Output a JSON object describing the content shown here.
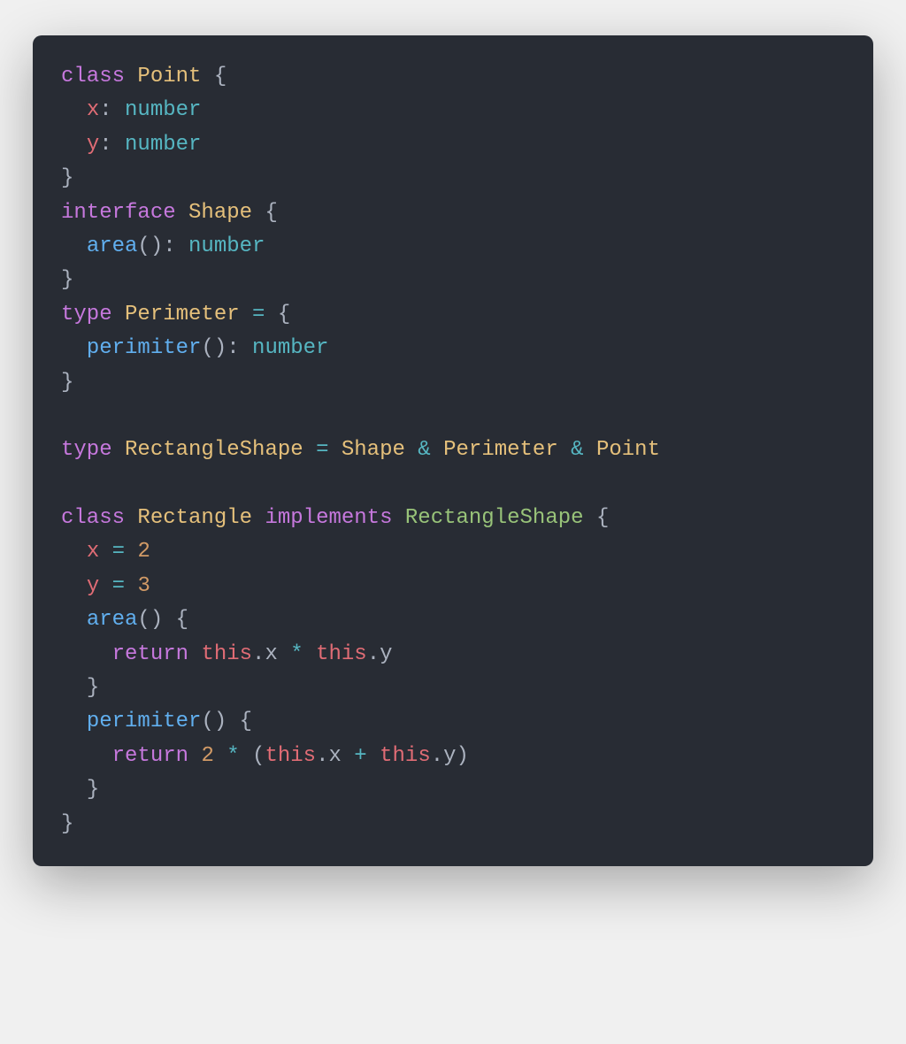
{
  "code": {
    "tokens": [
      [
        {
          "t": "class",
          "c": "kw"
        },
        {
          "t": " "
        },
        {
          "t": "Point",
          "c": "type"
        },
        {
          "t": " "
        },
        {
          "t": "{",
          "c": "punct"
        }
      ],
      [
        {
          "t": "  "
        },
        {
          "t": "x",
          "c": "prop"
        },
        {
          "t": ": "
        },
        {
          "t": "number",
          "c": "builtin"
        }
      ],
      [
        {
          "t": "  "
        },
        {
          "t": "y",
          "c": "prop"
        },
        {
          "t": ": "
        },
        {
          "t": "number",
          "c": "builtin"
        }
      ],
      [
        {
          "t": "}",
          "c": "punct"
        }
      ],
      [
        {
          "t": "interface",
          "c": "kw"
        },
        {
          "t": " "
        },
        {
          "t": "Shape",
          "c": "type"
        },
        {
          "t": " "
        },
        {
          "t": "{",
          "c": "punct"
        }
      ],
      [
        {
          "t": "  "
        },
        {
          "t": "area",
          "c": "method"
        },
        {
          "t": "(): "
        },
        {
          "t": "number",
          "c": "builtin"
        }
      ],
      [
        {
          "t": "}",
          "c": "punct"
        }
      ],
      [
        {
          "t": "type",
          "c": "kw"
        },
        {
          "t": " "
        },
        {
          "t": "Perimeter",
          "c": "type"
        },
        {
          "t": " "
        },
        {
          "t": "=",
          "c": "op"
        },
        {
          "t": " "
        },
        {
          "t": "{",
          "c": "punct"
        }
      ],
      [
        {
          "t": "  "
        },
        {
          "t": "perimiter",
          "c": "method"
        },
        {
          "t": "(): "
        },
        {
          "t": "number",
          "c": "builtin"
        }
      ],
      [
        {
          "t": "}",
          "c": "punct"
        }
      ],
      [
        {
          "t": ""
        }
      ],
      [
        {
          "t": "type",
          "c": "kw"
        },
        {
          "t": " "
        },
        {
          "t": "RectangleShape",
          "c": "type"
        },
        {
          "t": " "
        },
        {
          "t": "=",
          "c": "op"
        },
        {
          "t": " "
        },
        {
          "t": "Shape",
          "c": "type"
        },
        {
          "t": " "
        },
        {
          "t": "&",
          "c": "op"
        },
        {
          "t": " "
        },
        {
          "t": "Perimeter",
          "c": "type"
        },
        {
          "t": " "
        },
        {
          "t": "&",
          "c": "op"
        },
        {
          "t": " "
        },
        {
          "t": "Point",
          "c": "type"
        }
      ],
      [
        {
          "t": ""
        }
      ],
      [
        {
          "t": "class",
          "c": "kw"
        },
        {
          "t": " "
        },
        {
          "t": "Rectangle",
          "c": "type"
        },
        {
          "t": " "
        },
        {
          "t": "implements",
          "c": "kw"
        },
        {
          "t": " "
        },
        {
          "t": "RectangleShape",
          "c": "typename"
        },
        {
          "t": " "
        },
        {
          "t": "{",
          "c": "punct"
        }
      ],
      [
        {
          "t": "  "
        },
        {
          "t": "x",
          "c": "prop"
        },
        {
          "t": " "
        },
        {
          "t": "=",
          "c": "op"
        },
        {
          "t": " "
        },
        {
          "t": "2",
          "c": "num"
        }
      ],
      [
        {
          "t": "  "
        },
        {
          "t": "y",
          "c": "prop"
        },
        {
          "t": " "
        },
        {
          "t": "=",
          "c": "op"
        },
        {
          "t": " "
        },
        {
          "t": "3",
          "c": "num"
        }
      ],
      [
        {
          "t": "  "
        },
        {
          "t": "area",
          "c": "method"
        },
        {
          "t": "() "
        },
        {
          "t": "{",
          "c": "punct"
        }
      ],
      [
        {
          "t": "    "
        },
        {
          "t": "return",
          "c": "kw"
        },
        {
          "t": " "
        },
        {
          "t": "this",
          "c": "this"
        },
        {
          "t": ".x "
        },
        {
          "t": "*",
          "c": "op"
        },
        {
          "t": " "
        },
        {
          "t": "this",
          "c": "this"
        },
        {
          "t": ".y"
        }
      ],
      [
        {
          "t": "  "
        },
        {
          "t": "}",
          "c": "punct"
        }
      ],
      [
        {
          "t": "  "
        },
        {
          "t": "perimiter",
          "c": "method"
        },
        {
          "t": "() "
        },
        {
          "t": "{",
          "c": "punct"
        }
      ],
      [
        {
          "t": "    "
        },
        {
          "t": "return",
          "c": "kw"
        },
        {
          "t": " "
        },
        {
          "t": "2",
          "c": "num"
        },
        {
          "t": " "
        },
        {
          "t": "*",
          "c": "op"
        },
        {
          "t": " ("
        },
        {
          "t": "this",
          "c": "this"
        },
        {
          "t": ".x "
        },
        {
          "t": "+",
          "c": "op"
        },
        {
          "t": " "
        },
        {
          "t": "this",
          "c": "this"
        },
        {
          "t": ".y)"
        }
      ],
      [
        {
          "t": "  "
        },
        {
          "t": "}",
          "c": "punct"
        }
      ],
      [
        {
          "t": "}",
          "c": "punct"
        }
      ]
    ]
  },
  "colors": {
    "background": "#282c34",
    "foreground": "#abb2bf",
    "keyword": "#c678dd",
    "type": "#e5c07b",
    "typename": "#98c379",
    "property": "#e06c75",
    "method": "#61afef",
    "builtin": "#56b6c2",
    "number": "#d19a66",
    "operator": "#56b6c2"
  }
}
